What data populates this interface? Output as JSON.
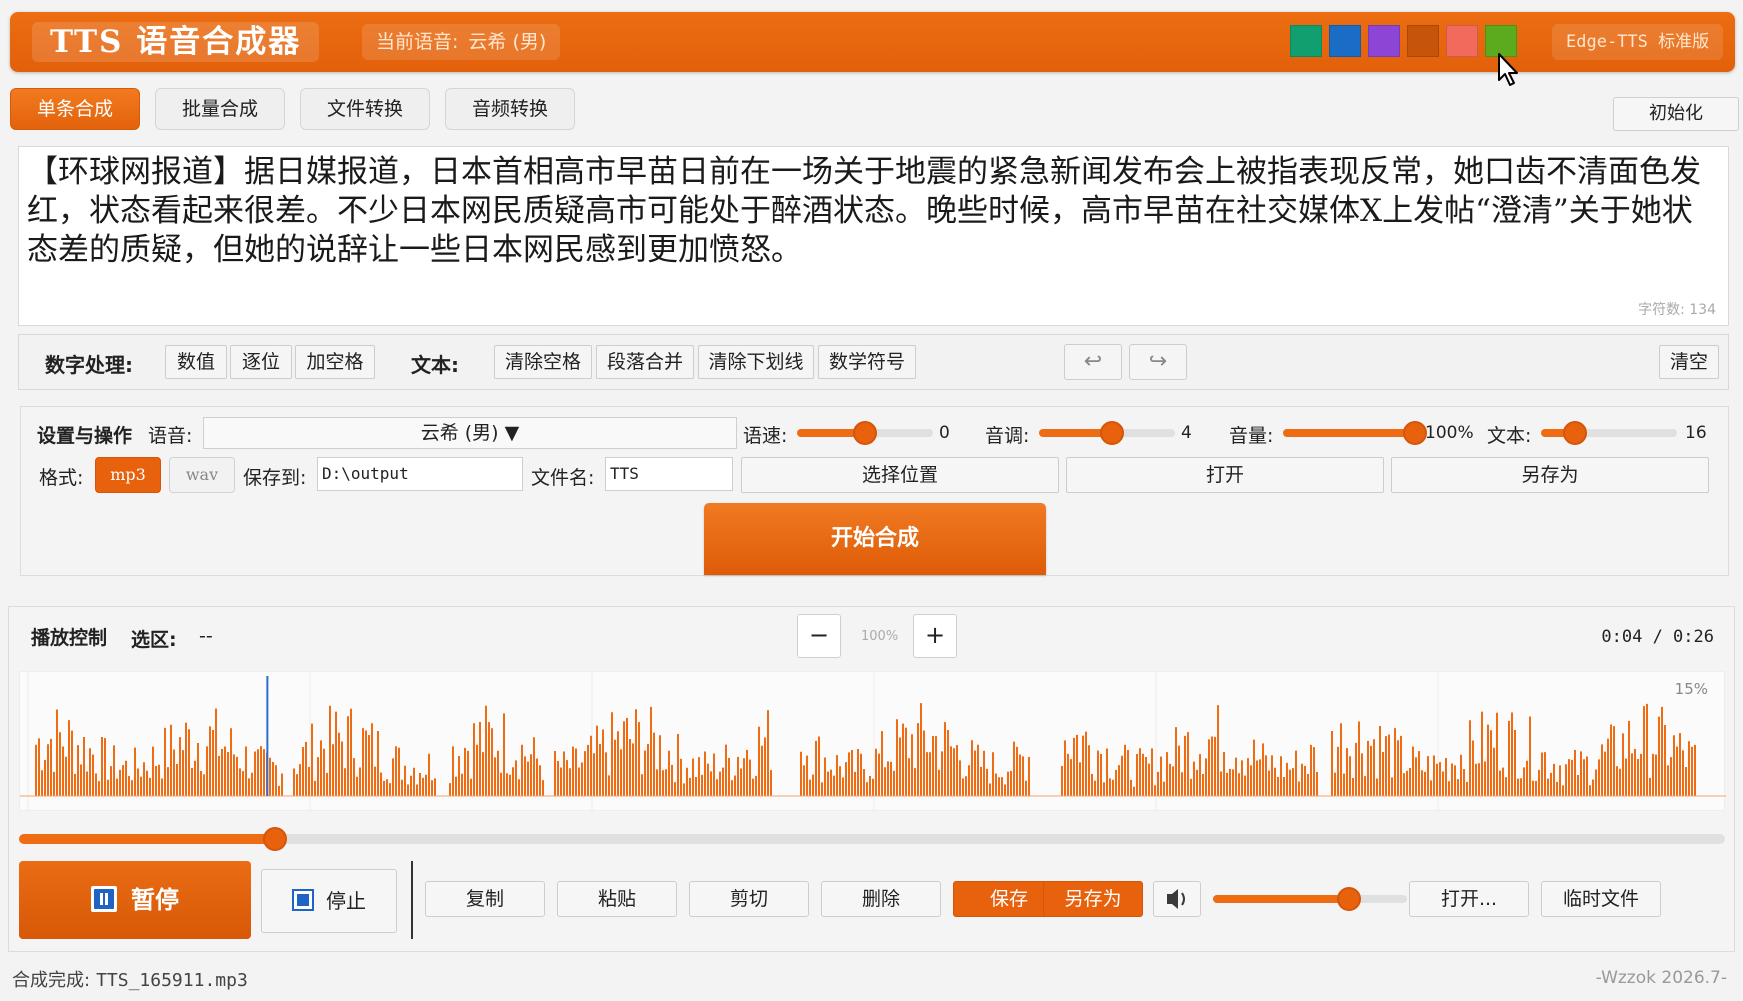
{
  "header": {
    "title": "TTS  语音合成器",
    "current_voice_label": "当前语音:",
    "current_voice_value": "云希 (男)",
    "edition": "Edge-TTS 标准版",
    "theme_swatches": [
      "#10a070",
      "#1b6cc4",
      "#8d45d6",
      "#c6550b",
      "#f26a5c",
      "#5cab1e"
    ]
  },
  "tabs": [
    {
      "label": "单条合成",
      "active": true
    },
    {
      "label": "批量合成",
      "active": false
    },
    {
      "label": "文件转换",
      "active": false
    },
    {
      "label": "音频转换",
      "active": false
    }
  ],
  "init_button": "初始化",
  "editor": {
    "text": "【环球网报道】据日媒报道，日本首相高市早苗日前在一场关于地震的紧急新闻发布会上被指表现反常，她口齿不清面色发红，状态看起来很差。不少日本网民质疑高市可能处于醉酒状态。晚些时候，高市早苗在社交媒体X上发帖“澄清”关于她状态差的质疑，但她的说辞让一些日本网民感到更加愤怒。",
    "char_count": "字符数: 134"
  },
  "toolbar": {
    "number_label": "数字处理:",
    "number_buttons": [
      "数值",
      "逐位",
      "加空格"
    ],
    "text_label": "文本:",
    "text_buttons": [
      "清除空格",
      "段落合并",
      "清除下划线",
      "数学符号"
    ],
    "undo": "↩",
    "redo": "↪",
    "clear": "清空"
  },
  "settings": {
    "section_label": "设置与操作",
    "voice_label": "语音:",
    "voice_value": "云希 (男) ▼",
    "speed_label": "语速:",
    "speed_value": "0",
    "speed_fraction": 0.5,
    "pitch_label": "音调:",
    "pitch_value": "4",
    "pitch_fraction": 0.54,
    "volume_label": "音量:",
    "volume_value": "100%",
    "volume_fraction": 1.0,
    "text_label": "文本:",
    "text_value": "16",
    "text_fraction": 0.25,
    "format_label": "格式:",
    "format_mp3": "mp3",
    "format_wav": "wav",
    "save_to_label": "保存到:",
    "save_to_value": "D:\\output",
    "filename_label": "文件名:",
    "filename_value": "TTS",
    "choose_location": "选择位置",
    "open": "打开",
    "save_as": "另存为",
    "start": "开始合成"
  },
  "playback": {
    "title": "播放控制",
    "selection_label": "选区:",
    "selection_value": "--",
    "zoom_out": "−",
    "zoom_value": "100%",
    "zoom_in": "+",
    "time": "0:04 / 0:26",
    "wave_percent": "15%",
    "progress_fraction": 0.15,
    "playhead_fraction": 0.145,
    "pause": "暂停",
    "stop": "停止",
    "buttons": [
      "复制",
      "粘贴",
      "剪切",
      "删除"
    ],
    "save": "保存",
    "save_as": "另存为",
    "volume_fraction": 0.7,
    "open": "打开...",
    "temp_file": "临时文件"
  },
  "status": {
    "left_label": "合成完成:",
    "left_file": "TTS_165911.mp3",
    "right": "-Wzzok 2026.7-"
  }
}
